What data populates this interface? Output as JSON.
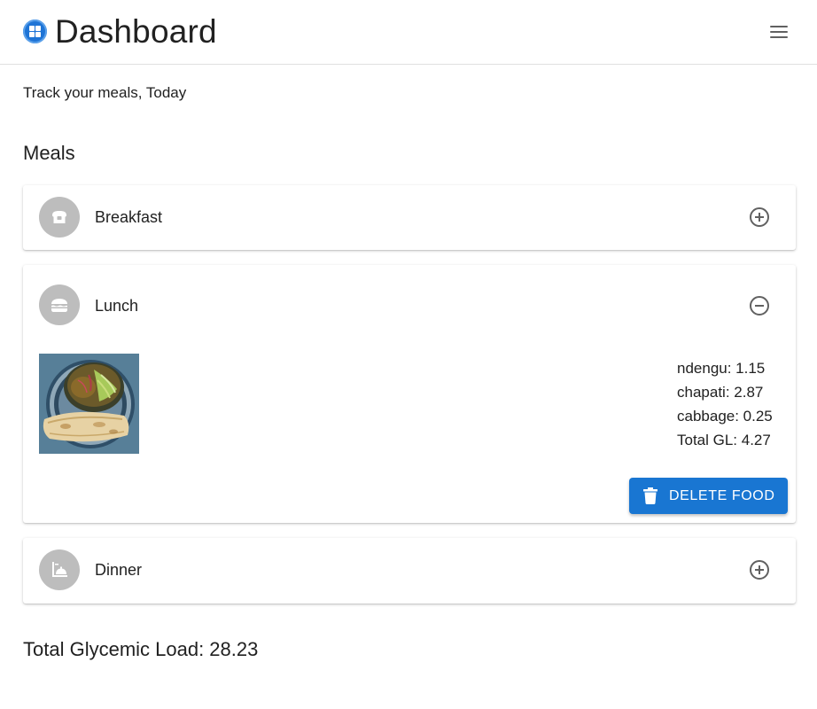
{
  "header": {
    "title": "Dashboard",
    "logo_icon": "dashboard-grid-icon",
    "menu_icon": "hamburger-menu-icon"
  },
  "subtitle": "Track your meals, Today",
  "section_title": "Meals",
  "meals": [
    {
      "label": "Breakfast",
      "icon": "toast-icon",
      "expanded": false,
      "toggle_icon": "add-circle-icon"
    },
    {
      "label": "Lunch",
      "icon": "burger-icon",
      "expanded": true,
      "toggle_icon": "remove-circle-icon",
      "photo": "plate with ndengu, chapati and cabbage",
      "nutrition": [
        "ndengu: 1.15",
        "chapati: 2.87",
        "cabbage: 0.25",
        "Total GL: 4.27"
      ],
      "delete_label": "DELETE FOOD",
      "delete_icon": "trash-icon"
    },
    {
      "label": "Dinner",
      "icon": "dinner-icon",
      "expanded": false,
      "toggle_icon": "add-circle-icon"
    }
  ],
  "total_glycemic_load": "Total Glycemic Load: 28.23",
  "colors": {
    "primary": "#1976d2",
    "avatar_bg": "#bdbdbd",
    "text": "#212121",
    "icon": "#616161"
  }
}
